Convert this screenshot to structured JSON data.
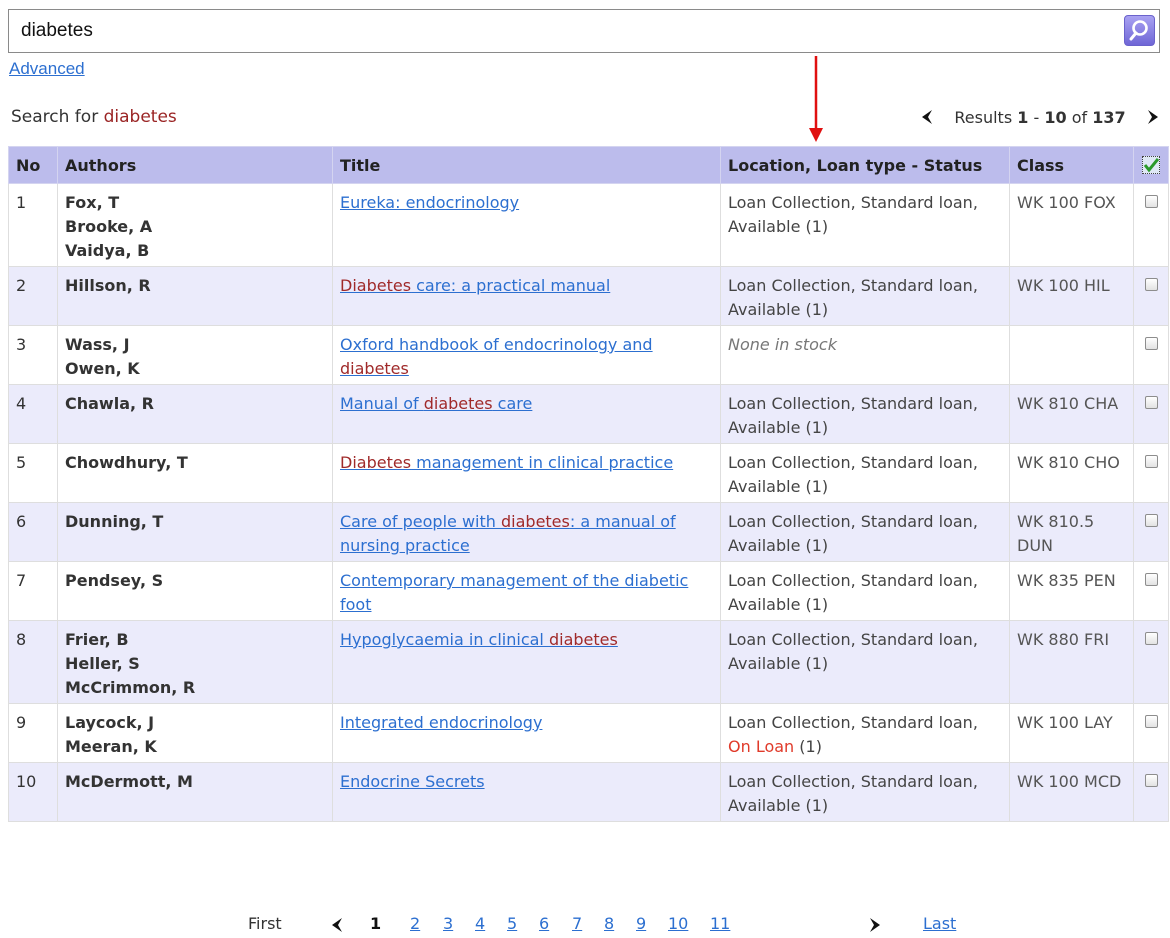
{
  "search": {
    "query": "diabetes",
    "button_icon": "search-icon"
  },
  "advanced_label": "Advanced",
  "summary": {
    "prefix": "Search for",
    "term": "diabetes"
  },
  "results_nav": {
    "label": "Results",
    "from": "1",
    "sep": "-",
    "to": "10",
    "of_label": "of",
    "total": "137"
  },
  "table": {
    "headers": [
      "No",
      "Authors",
      "Title",
      "Location, Loan type - Status",
      "Class"
    ],
    "rows": [
      {
        "no": "1",
        "authors": [
          "Fox, T",
          "Brooke, A",
          "Vaidya, B"
        ],
        "title": [
          [
            "Eureka: endocrinology",
            false
          ]
        ],
        "location": "Loan Collection, Standard loan, ",
        "status": "Available",
        "count": " (1)",
        "class": "WK 100 FOX"
      },
      {
        "no": "2",
        "authors": [
          "Hillson, R"
        ],
        "title": [
          [
            "Diabetes",
            true
          ],
          [
            " care: a practical manual",
            false
          ]
        ],
        "location": "Loan Collection, Standard loan, ",
        "status": "Available",
        "count": " (1)",
        "class": "WK 100 HIL"
      },
      {
        "no": "3",
        "authors": [
          "Wass, J",
          "Owen, K"
        ],
        "title": [
          [
            "Oxford handbook of endocrinology and ",
            false
          ],
          [
            "diabetes",
            true
          ]
        ],
        "location": "",
        "status": "None in stock",
        "count": "",
        "class": ""
      },
      {
        "no": "4",
        "authors": [
          "Chawla, R"
        ],
        "title": [
          [
            "Manual of ",
            false
          ],
          [
            "diabetes",
            true
          ],
          [
            " care",
            false
          ]
        ],
        "location": "Loan Collection, Standard loan, ",
        "status": "Available",
        "count": " (1)",
        "class": "WK 810 CHA"
      },
      {
        "no": "5",
        "authors": [
          "Chowdhury, T"
        ],
        "title": [
          [
            "Diabetes",
            true
          ],
          [
            " management in clinical practice",
            false
          ]
        ],
        "location": "Loan Collection, Standard loan, ",
        "status": "Available",
        "count": " (1)",
        "class": "WK 810 CHO"
      },
      {
        "no": "6",
        "authors": [
          "Dunning, T"
        ],
        "title": [
          [
            "Care of people with ",
            false
          ],
          [
            "diabetes",
            true
          ],
          [
            ": a manual of nursing practice",
            false
          ]
        ],
        "location": "Loan Collection, Standard loan, ",
        "status": "Available",
        "count": " (1)",
        "class": "WK 810.5 DUN"
      },
      {
        "no": "7",
        "authors": [
          "Pendsey, S"
        ],
        "title": [
          [
            "Contemporary management of the diabetic foot",
            false
          ]
        ],
        "location": "Loan Collection, Standard loan, ",
        "status": "Available",
        "count": " (1)",
        "class": "WK 835 PEN"
      },
      {
        "no": "8",
        "authors": [
          "Frier, B",
          "Heller, S",
          "McCrimmon, R"
        ],
        "title": [
          [
            "Hypoglycaemia in clinical ",
            false
          ],
          [
            "diabetes",
            true
          ]
        ],
        "location": "Loan Collection, Standard loan, ",
        "status": "Available",
        "count": " (1)",
        "class": "WK 880 FRI"
      },
      {
        "no": "9",
        "authors": [
          "Laycock, J",
          "Meeran, K"
        ],
        "title": [
          [
            "Integrated endocrinology",
            false
          ]
        ],
        "location": "Loan Collection, Standard loan, ",
        "status": "On Loan",
        "count": " (1)",
        "class": "WK 100 LAY"
      },
      {
        "no": "10",
        "authors": [
          "McDermott, M"
        ],
        "title": [
          [
            "Endocrine Secrets",
            false
          ]
        ],
        "location": "Loan Collection, Standard loan, ",
        "status": "Available",
        "count": " (1)",
        "class": "WK 100 MCD"
      }
    ]
  },
  "pagination": {
    "first": "First",
    "current": "1",
    "pages": [
      "2",
      "3",
      "4",
      "5",
      "6",
      "7",
      "8",
      "9",
      "10",
      "11"
    ],
    "last": "Last"
  },
  "colors": {
    "header_bg": "#bcbcec",
    "alt_row_bg": "#ebebfb",
    "link": "#2c6fd0",
    "highlight": "#a02a2a",
    "on_loan": "#e03a2a",
    "arrow": "#e01010"
  }
}
